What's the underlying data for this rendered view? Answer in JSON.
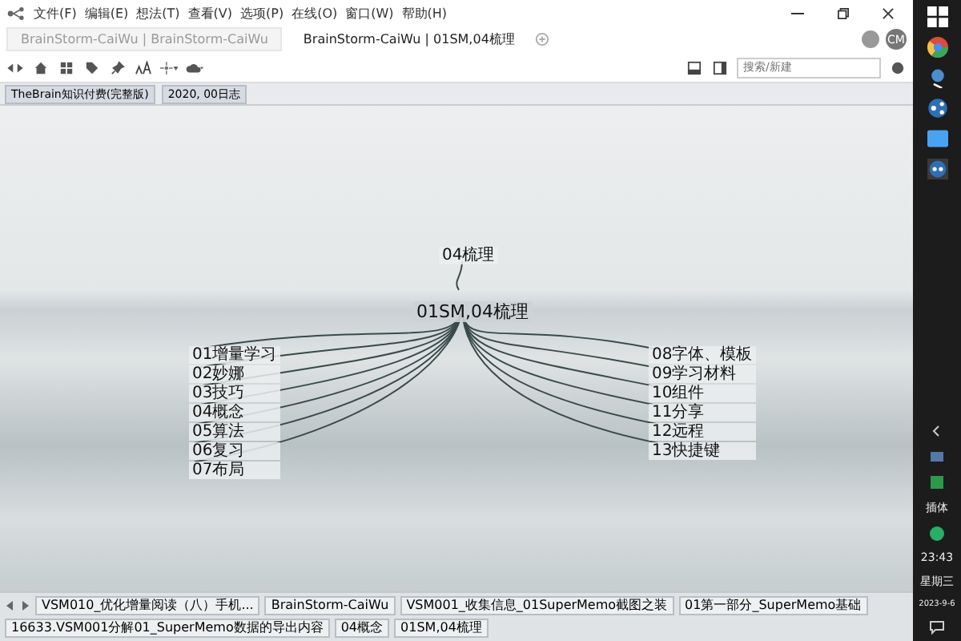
{
  "menu": [
    "文件(F)",
    "编辑(E)",
    "想法(T)",
    "查看(V)",
    "选项(P)",
    "在线(O)",
    "窗口(W)",
    "帮助(H)"
  ],
  "tabs": [
    {
      "label": "BrainStorm-CaiWu | BrainStorm-CaiWu",
      "selected": false
    },
    {
      "label": "BrainStorm-CaiWu | 01SM,04梳理",
      "selected": true
    }
  ],
  "avatar": "CM",
  "search": {
    "placeholder": "搜索/新建"
  },
  "bookmarks": [
    "TheBrain知识付费(完整版)",
    "2020, 00日志"
  ],
  "plex": {
    "parent": "04梳理",
    "active": "01SM,04梳理",
    "left_children": [
      "01增量学习",
      "02妙娜",
      "03技巧",
      "04概念",
      "05算法",
      "06复习",
      "07布局"
    ],
    "right_children": [
      "08字体、模板",
      "09学习材料",
      "10组件",
      "11分享",
      "12远程",
      "13快捷键"
    ]
  },
  "taskbar": {
    "items": [
      "VSM010_优化增量阅读（八）手机...",
      "BrainStorm-CaiWu",
      "VSM001_收集信息_01SuperMemo截图之装",
      "01第一部分_SuperMemo基础",
      "16633.VSM001分解01_SuperMemo数据的导出内容",
      "04概念",
      "01SM,04梳理"
    ]
  },
  "side_taskbar": {
    "ime": "插体",
    "time": "23:43",
    "weekday": "星期三",
    "date": "2023-9-6"
  }
}
